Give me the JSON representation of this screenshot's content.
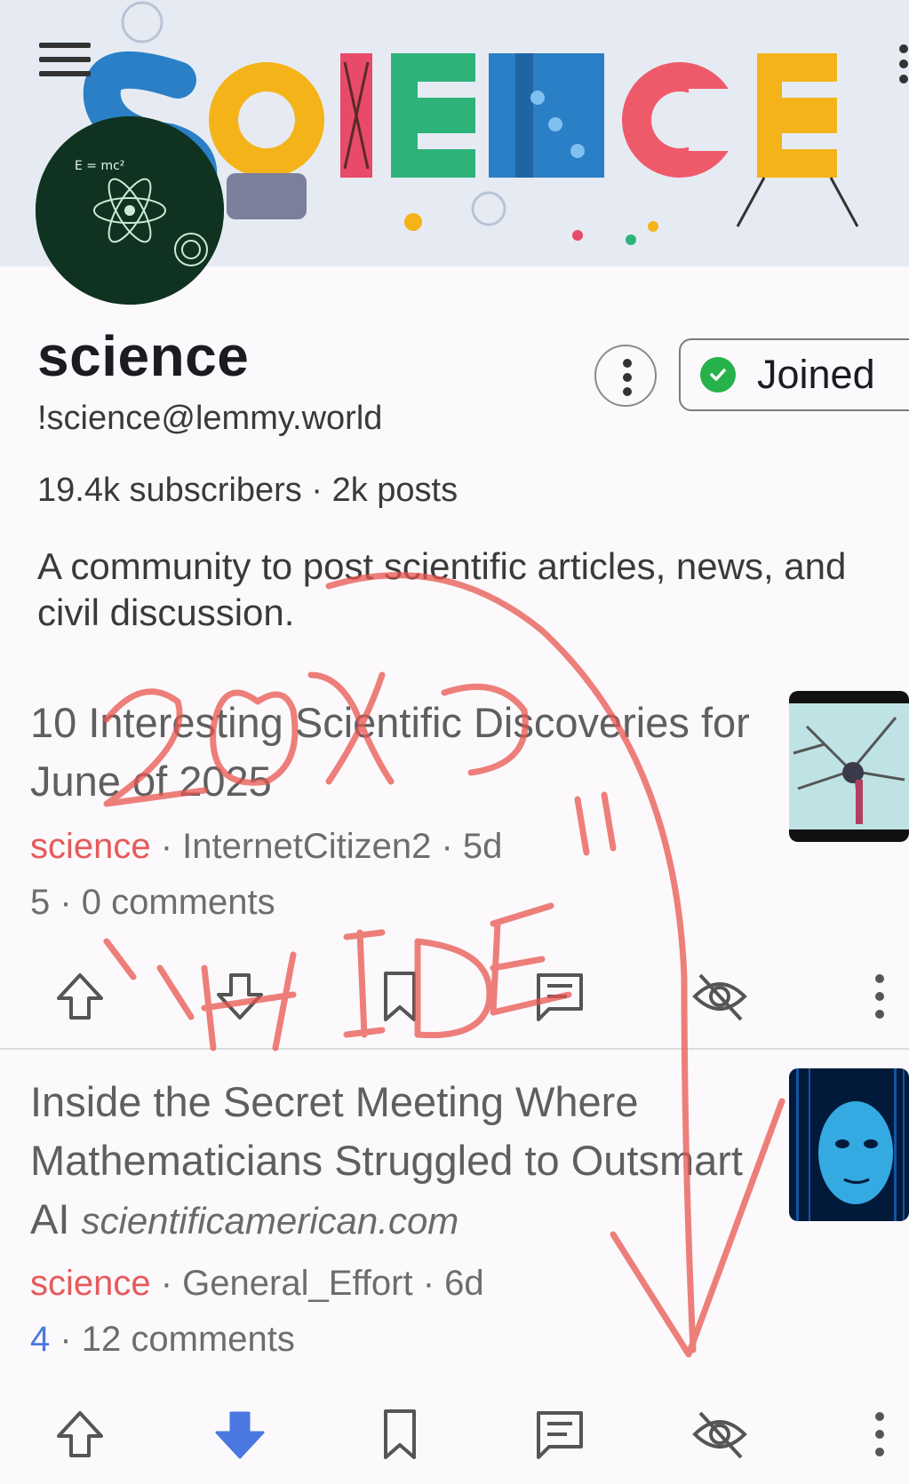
{
  "banner": {
    "logo_text": "SCIENCE",
    "menu_icon": "hamburger-menu-icon",
    "more_icon": "more-vertical-icon"
  },
  "community": {
    "name": "science",
    "handle": "!science@lemmy.world",
    "stats": "19.4k subscribers · 2k posts",
    "description": "A community to post scientific articles, news, and civil discussion.",
    "joined_label": "Joined",
    "avatar_text": "E = mc²"
  },
  "posts": [
    {
      "title": "10 Interesting Scientific Discoveries for June of 2025",
      "domain": "",
      "community": "science",
      "sep": " · ",
      "author": "InternetCitizen2",
      "age": "5d",
      "score": "5",
      "comments": "0 comments",
      "vote_state": "none",
      "thumbnail": "neuron-image"
    },
    {
      "title": "Inside the Secret Meeting Where Mathematicians Struggled to Outsmart AI",
      "domain": "scientificamerican.com",
      "community": "science",
      "sep": " · ",
      "author": "General_Effort",
      "age": "6d",
      "score": "4",
      "comments": "12 comments",
      "vote_state": "downvoted",
      "thumbnail": "ai-face-image"
    }
  ],
  "annotation": {
    "text": "20x \"HIDE\"",
    "color": "#e8564f"
  },
  "colors": {
    "accent_red": "#e65a5a",
    "accent_blue": "#4a78e0",
    "joined_check": "#25b24a",
    "scribble": "#e8564f"
  }
}
